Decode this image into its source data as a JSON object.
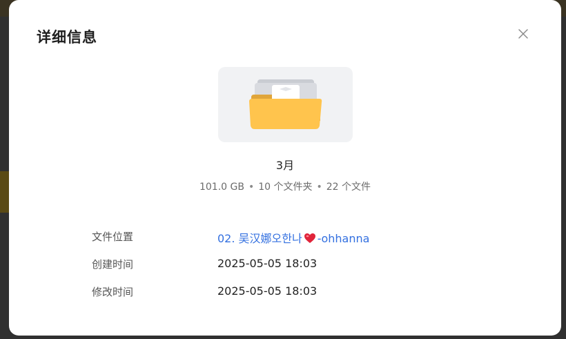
{
  "dialog": {
    "title": "详细信息",
    "close_icon": "close-icon"
  },
  "item": {
    "thumbnail_icon": "folder-icon",
    "name": "3月",
    "size": "101.0 GB",
    "folders": "10 个文件夹",
    "files": "22 个文件",
    "separator": "•"
  },
  "details": {
    "location": {
      "label": "文件位置",
      "value_prefix": "02. 吴汉娜오한나",
      "value_emoji_icon": "red-heart-icon",
      "value_suffix": "-ohhanna"
    },
    "created": {
      "label": "创建时间",
      "value": "2025-05-05 18:03"
    },
    "modified": {
      "label": "修改时间",
      "value": "2025-05-05 18:03"
    }
  },
  "colors": {
    "link": "#3370e0",
    "folder": "#ffc44d",
    "folder_back": "#e0a53a"
  }
}
